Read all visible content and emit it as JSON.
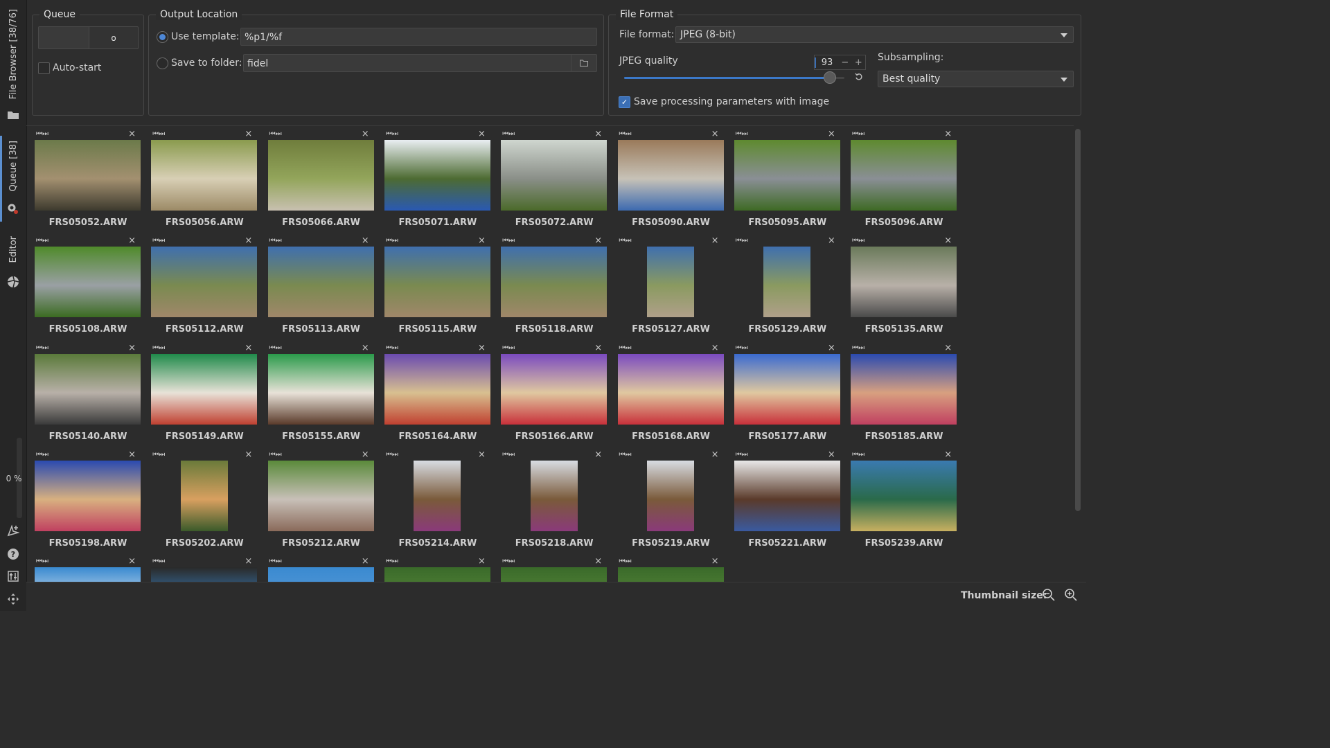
{
  "sidebar": {
    "file_browser_label": "File Browser [38/76]",
    "queue_label": "Queue [38]",
    "editor_label": "Editor",
    "progress_percent": "0 %",
    "progress_value": 0
  },
  "queue": {
    "title": "Queue",
    "start_button_symbol": "o",
    "auto_start_label": "Auto-start",
    "auto_start_checked": false
  },
  "output": {
    "title": "Output Location",
    "use_template_label": "Use template:",
    "template_value": "%p1/%f",
    "save_to_folder_label": "Save to folder:",
    "folder_value": "fidel"
  },
  "format": {
    "title": "File Format",
    "file_format_label": "File format:",
    "file_format_value": "JPEG (8-bit)",
    "jpeg_quality_label": "JPEG quality",
    "jpeg_quality_value": "93",
    "subsampling_label": "Subsampling:",
    "subsampling_value": "Best quality",
    "save_params_label": "Save processing parameters with image",
    "save_params_checked": true
  },
  "thumbnails": [
    {
      "name": "FRS05052.ARW",
      "colors": [
        "#6b7a4a",
        "#a39070",
        "#3d3a2e"
      ]
    },
    {
      "name": "FRS05056.ARW",
      "colors": [
        "#8a9b4e",
        "#d8cfb5",
        "#9c8a66"
      ]
    },
    {
      "name": "FRS05066.ARW",
      "colors": [
        "#6f7d3c",
        "#93a55b",
        "#c8c0b0"
      ]
    },
    {
      "name": "FRS05071.ARW",
      "colors": [
        "#e9eef2",
        "#4d6b32",
        "#2a59b3"
      ]
    },
    {
      "name": "FRS05072.ARW",
      "colors": [
        "#cfd6cf",
        "#8a8f88",
        "#4b6a2a"
      ]
    },
    {
      "name": "FRS05090.ARW",
      "colors": [
        "#9a7a5a",
        "#c7c2b7",
        "#3c6ab0"
      ]
    },
    {
      "name": "FRS05095.ARW",
      "colors": [
        "#5e8a2f",
        "#8a8f95",
        "#3e6a24"
      ]
    },
    {
      "name": "FRS05096.ARW",
      "colors": [
        "#5e8a2f",
        "#8a8f95",
        "#3e6a24"
      ]
    },
    {
      "name": "FRS05108.ARW",
      "colors": [
        "#4f8a2a",
        "#9aa0a4",
        "#3b6b21"
      ]
    },
    {
      "name": "FRS05112.ARW",
      "colors": [
        "#3f6fae",
        "#7a8a50",
        "#a0876a"
      ]
    },
    {
      "name": "FRS05113.ARW",
      "colors": [
        "#3f6fae",
        "#7a8a50",
        "#a0876a"
      ]
    },
    {
      "name": "FRS05115.ARW",
      "colors": [
        "#3f6fae",
        "#7a8a50",
        "#a0876a"
      ]
    },
    {
      "name": "FRS05118.ARW",
      "colors": [
        "#3f6fae",
        "#7a8a50",
        "#a0876a"
      ]
    },
    {
      "name": "FRS05127.ARW",
      "colors": [
        "#3f6fae",
        "#8a9a60",
        "#b0a08a"
      ]
    },
    {
      "name": "FRS05129.ARW",
      "colors": [
        "#3f6fae",
        "#8a9a60",
        "#b0a08a"
      ]
    },
    {
      "name": "FRS05135.ARW",
      "colors": [
        "#6a7a5a",
        "#b8b0a8",
        "#4a4a4a"
      ]
    },
    {
      "name": "FRS05140.ARW",
      "colors": [
        "#5a7a3a",
        "#b8b0a8",
        "#3a3a3a"
      ]
    },
    {
      "name": "FRS05149.ARW",
      "colors": [
        "#1f8a4a",
        "#e8e2d8",
        "#c04030"
      ]
    },
    {
      "name": "FRS05155.ARW",
      "colors": [
        "#2a9a4a",
        "#e8e2d8",
        "#5a3a2a"
      ]
    },
    {
      "name": "FRS05164.ARW",
      "colors": [
        "#6a4ab0",
        "#d8c090",
        "#c04030"
      ]
    },
    {
      "name": "FRS05166.ARW",
      "colors": [
        "#7a4ac0",
        "#e0c8a0",
        "#c8303a"
      ]
    },
    {
      "name": "FRS05168.ARW",
      "colors": [
        "#7a4ac0",
        "#e0c8a0",
        "#c8303a"
      ]
    },
    {
      "name": "FRS05177.ARW",
      "colors": [
        "#3a6ad0",
        "#e0c8a0",
        "#c8303a"
      ]
    },
    {
      "name": "FRS05185.ARW",
      "colors": [
        "#2a4ab0",
        "#d8a080",
        "#c04060"
      ]
    },
    {
      "name": "FRS05198.ARW",
      "colors": [
        "#2a4ab0",
        "#d8b080",
        "#c04060"
      ]
    },
    {
      "name": "FRS05202.ARW",
      "colors": [
        "#6a7a3a",
        "#d8a060",
        "#3a5a2a"
      ]
    },
    {
      "name": "FRS05212.ARW",
      "colors": [
        "#5a8a3a",
        "#c8c0b8",
        "#8a6a5a"
      ]
    },
    {
      "name": "FRS05214.ARW",
      "colors": [
        "#d8dce2",
        "#7a5a3a",
        "#8a3a7a"
      ]
    },
    {
      "name": "FRS05218.ARW",
      "colors": [
        "#d8dce2",
        "#7a5a3a",
        "#8a3a7a"
      ]
    },
    {
      "name": "FRS05219.ARW",
      "colors": [
        "#d8dce2",
        "#7a5a3a",
        "#8a3a7a"
      ]
    },
    {
      "name": "FRS05221.ARW",
      "colors": [
        "#e8e8e8",
        "#5a3a2a",
        "#3a5aa0"
      ]
    },
    {
      "name": "FRS05239.ARW",
      "colors": [
        "#3a7ab0",
        "#2a6a4a",
        "#c8b060"
      ]
    },
    {
      "name": "",
      "colors": [
        "#3a8ad0",
        "#e0e8f0",
        "#2a3a5a"
      ]
    },
    {
      "name": "",
      "colors": [
        "#2a2a2a",
        "#3a8ad0",
        "#e0e8f0"
      ]
    },
    {
      "name": "",
      "colors": [
        "#3a8ad0",
        "#5a9ad8",
        "#e0e8f0"
      ]
    },
    {
      "name": "",
      "colors": [
        "#3a6a2a",
        "#5a8a3a",
        "#2a4a1a"
      ]
    },
    {
      "name": "",
      "colors": [
        "#3a6a2a",
        "#5a8a3a",
        "#2a4a1a"
      ]
    },
    {
      "name": "",
      "colors": [
        "#3a6a2a",
        "#5a8a3a",
        "#2a4a1a"
      ]
    }
  ],
  "bottom": {
    "thumbnail_size_label": "Thumbnail size:"
  }
}
